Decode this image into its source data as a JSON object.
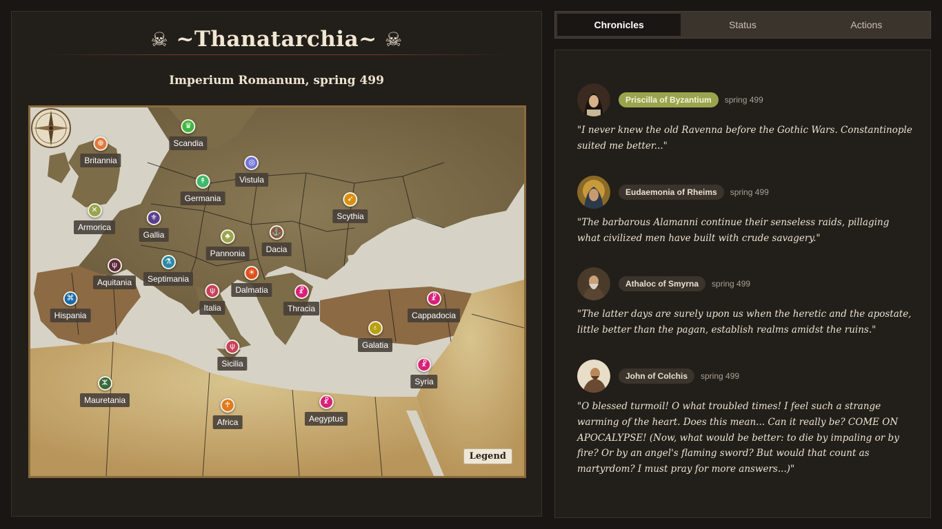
{
  "game": {
    "title": "~Thanatarchia~",
    "title_icon": "☠",
    "subtitle": "Imperium Romanum, spring 499",
    "legend_label": "Legend"
  },
  "map": {
    "regions": [
      {
        "name": "Britannia",
        "symbol": "⊕",
        "color": "#e07a3c"
      },
      {
        "name": "Scandia",
        "symbol": "♛",
        "color": "#3fb83f"
      },
      {
        "name": "Vistula",
        "symbol": "◎",
        "color": "#6f74d6"
      },
      {
        "name": "Germania",
        "symbol": "↟",
        "color": "#3fb86a"
      },
      {
        "name": "Armorica",
        "symbol": "✕",
        "color": "#9aa44c"
      },
      {
        "name": "Gallia",
        "symbol": "⚜",
        "color": "#5b3f8c"
      },
      {
        "name": "Scythia",
        "symbol": "➶",
        "color": "#d8900e"
      },
      {
        "name": "Pannonia",
        "symbol": "♣",
        "color": "#9aa44c"
      },
      {
        "name": "Dacia",
        "symbol": "⚓",
        "color": "#8c5a3a"
      },
      {
        "name": "Aquitania",
        "symbol": "ψ",
        "color": "#5a2a3a"
      },
      {
        "name": "Septimania",
        "symbol": "⚗",
        "color": "#2a8aa8"
      },
      {
        "name": "Dalmatia",
        "symbol": "☀",
        "color": "#e0501c"
      },
      {
        "name": "Hispania",
        "symbol": "⌘",
        "color": "#1a6aa8"
      },
      {
        "name": "Italia",
        "symbol": "ψ",
        "color": "#c8405a"
      },
      {
        "name": "Thracia",
        "symbol": "☧",
        "color": "#d8207a"
      },
      {
        "name": "Cappadocia",
        "symbol": "☧",
        "color": "#d8207a"
      },
      {
        "name": "Galatia",
        "symbol": "♁",
        "color": "#b8a010"
      },
      {
        "name": "Sicilia",
        "symbol": "ψ",
        "color": "#c8405a"
      },
      {
        "name": "Syria",
        "symbol": "☧",
        "color": "#d8207a"
      },
      {
        "name": "Mauretania",
        "symbol": "ⵣ",
        "color": "#3a6a3a"
      },
      {
        "name": "Africa",
        "symbol": "♰",
        "color": "#e07a1c"
      },
      {
        "name": "Aegyptus",
        "symbol": "☧",
        "color": "#d8207a"
      }
    ]
  },
  "tabs": [
    {
      "label": "Chronicles",
      "active": true
    },
    {
      "label": "Status",
      "active": false
    },
    {
      "label": "Actions",
      "active": false
    }
  ],
  "chronicles": [
    {
      "name": "Priscilla of Byzantium",
      "date": "spring 499",
      "highlighted": true,
      "quote": "\"I never knew the old Ravenna before the Gothic Wars. Constantinople suited me better...\""
    },
    {
      "name": "Eudaemonia of Rheims",
      "date": "spring 499",
      "highlighted": false,
      "quote": "\"The barbarous Alamanni continue their senseless raids, pillaging what civilized men have built with crude savagery.\""
    },
    {
      "name": "Athaloc of Smyrna",
      "date": "spring 499",
      "highlighted": false,
      "quote": "\"The latter days are surely upon us when the heretic and the apostate, little better than the pagan, establish realms amidst the ruins.\""
    },
    {
      "name": "John of Colchis",
      "date": "spring 499",
      "highlighted": false,
      "quote": "\"O blessed turmoil! O what troubled times! I feel such a strange warming of the heart. Does this mean... Can it really be? COME ON APOCALYPSE! (Now, what would be better: to die by impaling or by fire? Or by an angel's flaming sword? But would that count as martyrdom? I must pray for more answers...)\""
    }
  ]
}
